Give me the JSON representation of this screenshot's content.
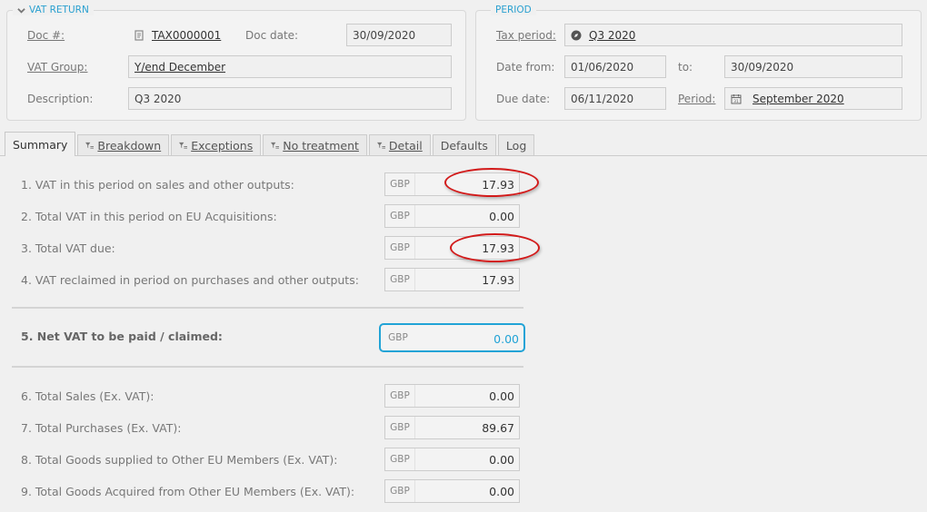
{
  "vat_return": {
    "legend": "VAT RETURN",
    "doc_label": "Doc #:",
    "doc_value": "TAX0000001",
    "doc_date_label": "Doc date:",
    "doc_date_value": "30/09/2020",
    "vat_group_label": "VAT Group:",
    "vat_group_value": "Y/end December",
    "description_label": "Description:",
    "description_value": "Q3 2020"
  },
  "period": {
    "legend": "PERIOD",
    "tax_period_label": "Tax period:",
    "tax_period_value": "Q3 2020",
    "date_from_label": "Date from:",
    "date_from_value": "01/06/2020",
    "to_label": "to:",
    "to_value": "30/09/2020",
    "due_date_label": "Due date:",
    "due_date_value": "06/11/2020",
    "period_label": "Period:",
    "period_value": "September 2020"
  },
  "tabs": [
    {
      "label": "Summary"
    },
    {
      "label": "Breakdown"
    },
    {
      "label": "Exceptions"
    },
    {
      "label": "No treatment"
    },
    {
      "label": "Detail"
    },
    {
      "label": "Defaults"
    },
    {
      "label": "Log"
    }
  ],
  "summary": {
    "currency": "GBP",
    "rows": [
      {
        "label": "1. VAT in this period on sales and other outputs:",
        "value": "17.93"
      },
      {
        "label": "2. Total VAT in this period on EU Acquisitions:",
        "value": "0.00"
      },
      {
        "label": "3. Total VAT due:",
        "value": "17.93"
      },
      {
        "label": "4. VAT reclaimed in period on purchases and other outputs:",
        "value": "17.93"
      },
      {
        "label": "5. Net VAT to be paid / claimed:",
        "value": "0.00"
      },
      {
        "label": "6. Total Sales (Ex. VAT):",
        "value": "0.00"
      },
      {
        "label": "7. Total Purchases (Ex. VAT):",
        "value": "89.67"
      },
      {
        "label": "8. Total Goods supplied to Other EU Members (Ex. VAT):",
        "value": "0.00"
      },
      {
        "label": "9. Total Goods Acquired from Other EU Members (Ex. VAT):",
        "value": "0.00"
      }
    ]
  },
  "colors": {
    "accent": "#21a3d6",
    "highlight_ring": "#d21a1a"
  }
}
